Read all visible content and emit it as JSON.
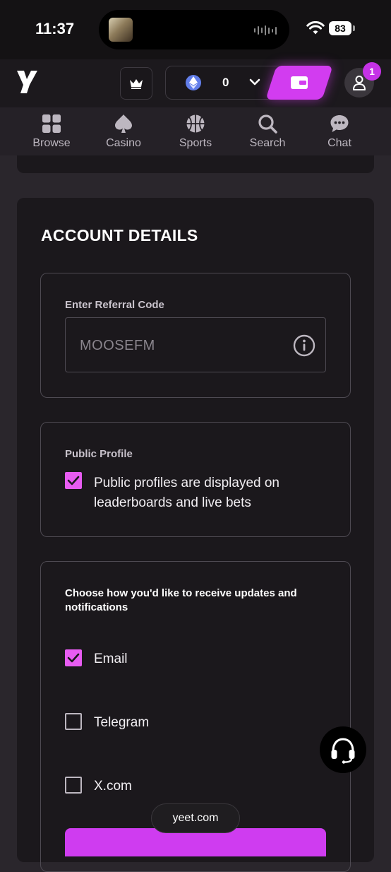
{
  "status_bar": {
    "time": "11:37",
    "battery": "83"
  },
  "header": {
    "balance": "0",
    "notification_count": "1"
  },
  "nav": {
    "items": [
      {
        "label": "Browse",
        "icon": "grid-icon"
      },
      {
        "label": "Casino",
        "icon": "spade-icon"
      },
      {
        "label": "Sports",
        "icon": "basketball-icon"
      },
      {
        "label": "Search",
        "icon": "search-icon"
      },
      {
        "label": "Chat",
        "icon": "chat-bubble-icon"
      }
    ]
  },
  "account": {
    "title": "ACCOUNT DETAILS",
    "referral": {
      "label": "Enter Referral Code",
      "placeholder": "MOOSEFM"
    },
    "public_profile": {
      "label": "Public Profile",
      "checked": true,
      "text_line1": "Public profiles are displayed on",
      "text_line2": "leaderboards and live bets"
    },
    "notifications": {
      "label_line1": "Choose how you'd like to receive updates and",
      "label_line2": "notifications",
      "options": [
        {
          "label": "Email",
          "checked": true
        },
        {
          "label": "Telegram",
          "checked": false
        },
        {
          "label": "X.com",
          "checked": false
        }
      ]
    }
  },
  "browser": {
    "url": "yeet.com"
  },
  "colors": {
    "accent": "#d23cf0",
    "checkbox_on": "#e85cf2",
    "card_bg": "#1b181c",
    "page_bg": "#2a262c"
  }
}
